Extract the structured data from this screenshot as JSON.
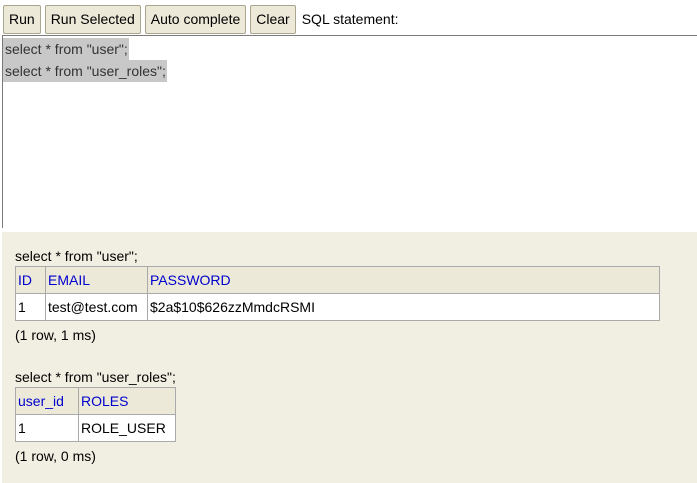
{
  "toolbar": {
    "run_label": "Run",
    "run_selected_label": "Run Selected",
    "auto_complete_label": "Auto complete",
    "clear_label": "Clear",
    "sql_statement_label": "SQL statement:"
  },
  "editor": {
    "lines": [
      "select * from \"user\";",
      "select * from \"user_roles\";"
    ]
  },
  "results": [
    {
      "query": "select * from \"user\";",
      "columns": [
        "ID",
        "EMAIL",
        "PASSWORD"
      ],
      "rows": [
        [
          "1",
          "test@test.com",
          "$2a$10$626zzMmdcRSMI"
        ]
      ],
      "summary": "(1 row, 1 ms)"
    },
    {
      "query": "select * from \"user_roles\";",
      "columns": [
        "user_id",
        "ROLES"
      ],
      "rows": [
        [
          "1",
          "ROLE_USER"
        ]
      ],
      "summary": "(1 row, 0 ms)"
    }
  ]
}
